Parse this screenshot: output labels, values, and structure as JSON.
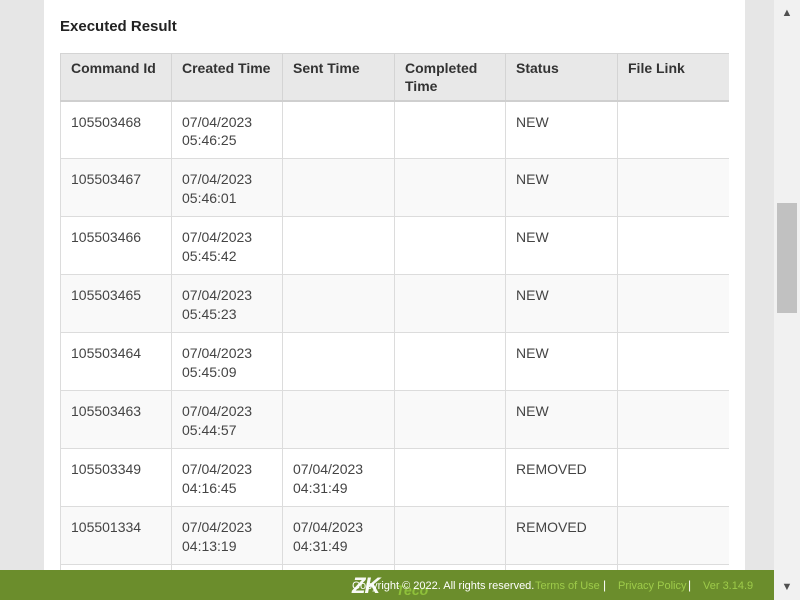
{
  "section_title": "Executed Result",
  "columns": [
    "Command Id",
    "Created Time",
    "Sent Time",
    "Completed\nTime",
    "Status",
    "File Link"
  ],
  "rows": [
    {
      "command_id": "105503468",
      "created": "07/04/2023\n05:46:25",
      "sent": "",
      "completed": "",
      "status": "NEW",
      "file_link": ""
    },
    {
      "command_id": "105503467",
      "created": "07/04/2023\n05:46:01",
      "sent": "",
      "completed": "",
      "status": "NEW",
      "file_link": ""
    },
    {
      "command_id": "105503466",
      "created": "07/04/2023\n05:45:42",
      "sent": "",
      "completed": "",
      "status": "NEW",
      "file_link": ""
    },
    {
      "command_id": "105503465",
      "created": "07/04/2023\n05:45:23",
      "sent": "",
      "completed": "",
      "status": "NEW",
      "file_link": ""
    },
    {
      "command_id": "105503464",
      "created": "07/04/2023\n05:45:09",
      "sent": "",
      "completed": "",
      "status": "NEW",
      "file_link": ""
    },
    {
      "command_id": "105503463",
      "created": "07/04/2023\n05:44:57",
      "sent": "",
      "completed": "",
      "status": "NEW",
      "file_link": ""
    },
    {
      "command_id": "105503349",
      "created": "07/04/2023\n04:16:45",
      "sent": "07/04/2023\n04:31:49",
      "completed": "",
      "status": "REMOVED",
      "file_link": ""
    },
    {
      "command_id": "105501334",
      "created": "07/04/2023\n04:13:19",
      "sent": "07/04/2023\n04:31:49",
      "completed": "",
      "status": "REMOVED",
      "file_link": ""
    },
    {
      "command_id": "",
      "created": "",
      "sent": "",
      "completed": "",
      "status": "",
      "file_link": ""
    }
  ],
  "footer": {
    "logo": "ZK",
    "logo_sub": "Teco",
    "copyright": "Copyright © 2022. All rights reserved.",
    "links": [
      "Terms of Use",
      "Privacy Policy",
      "Ver 3.14.9"
    ]
  },
  "colors": {
    "footer_bg": "#6b8d2c",
    "link": "#9ecb4a"
  }
}
